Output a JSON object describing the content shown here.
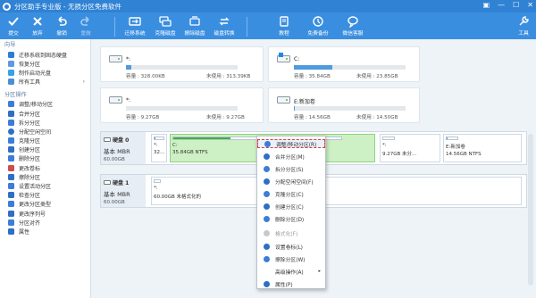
{
  "window": {
    "title": "分区助手专业版 - 无损分区免费软件",
    "controls": [
      "▣",
      "—",
      "☐",
      "✕"
    ]
  },
  "toolbar": {
    "items": [
      "提交",
      "放弃",
      "撤销",
      "重做",
      "迁移系统",
      "克隆磁盘",
      "擦除磁盘",
      "磁盘转换",
      "教程",
      "免费备份",
      "微信客服",
      "工具"
    ]
  },
  "sidebar": {
    "sections": [
      "向导",
      "分区操作"
    ],
    "wizard": [
      "迁移系统到固态硬盘",
      "恢复分区",
      "制作启动光盘",
      "所有工具"
    ],
    "ops": [
      "调整/移动分区",
      "合并分区",
      "拆分分区",
      "分配空闲空间",
      "克隆分区",
      "创建分区",
      "删除分区",
      "更改卷标",
      "擦除分区",
      "设置活动分区",
      "检查分区",
      "更改分区类型",
      "更改序列号",
      "分区对齐",
      "属性"
    ],
    "more_arrow": "›"
  },
  "cards": [
    {
      "name": "*:",
      "cap": "容量 : 328.00KB",
      "free": "未使用 : 313.39KB",
      "fill": 0.05
    },
    {
      "name": "C:",
      "cap": "容量 : 35.84GB",
      "free": "未使用 : 23.85GB",
      "fill": 0.34
    },
    {
      "name": "*:",
      "cap": "容量 : 9.27GB",
      "free": "未使用 : 9.27GB",
      "fill": 0.0
    },
    {
      "name": "E:新加卷",
      "cap": "容量 : 14.56GB",
      "free": "未使用 : 14.50GB",
      "fill": 0.01
    }
  ],
  "disk0": {
    "name": "硬盘 0",
    "type": "基本 MBR",
    "size": "60.00GB",
    "parts": [
      {
        "label": "*:",
        "info": "32...",
        "fill": 0.05
      },
      {
        "label": "C:",
        "info": "35.84GB NTFS",
        "fill": 0.34
      },
      {
        "label": "*:",
        "info": "9.27GB 未分...",
        "fill": 0.0
      },
      {
        "label": "E:新加卷",
        "info": "14.56GB NTFS",
        "fill": 0.01
      }
    ]
  },
  "disk1": {
    "name": "硬盘 1",
    "type": "基本 MBR",
    "size": "60.00GB",
    "part": "*:",
    "info": "60.00GB 未格式化的"
  },
  "menu": [
    "调整/移动分区(R)",
    "合并分区(M)",
    "拆分分区(S)",
    "分配空闲空间(F)",
    "克隆分区(C)",
    "创建分区(C)",
    "删除分区(D)",
    "格式化(F)",
    "设置卷标(L)",
    "擦除分区(W)",
    "高级操作(A)",
    "属性(P)"
  ],
  "menu_submenu": "▸",
  "colors": {
    "accent": "#3a8ee0",
    "selected": "#cdf0c4",
    "highlight": "#e53935"
  }
}
